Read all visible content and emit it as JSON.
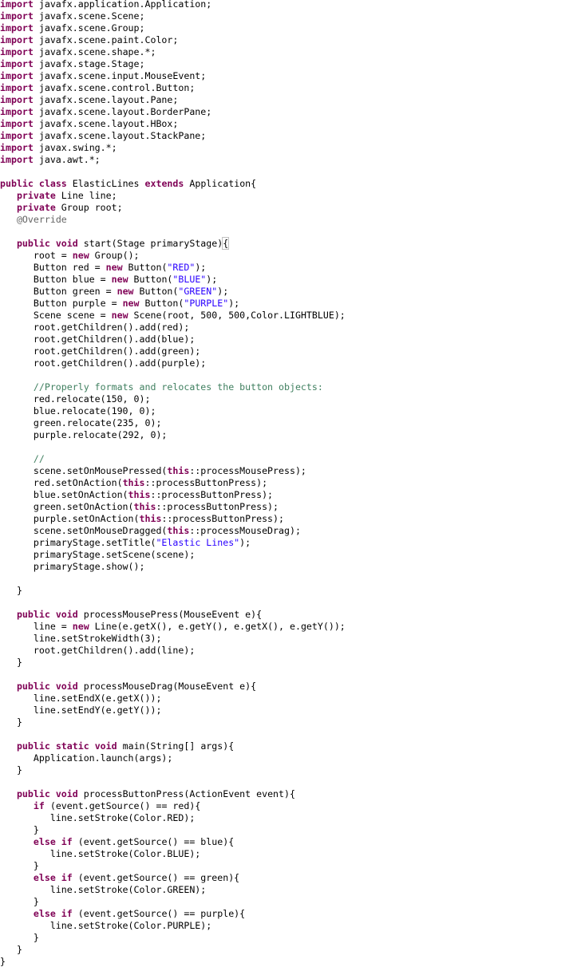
{
  "editor": {
    "language": "java",
    "file_class": "ElasticLines",
    "lines": [
      [
        {
          "t": "import",
          "k": "kw"
        },
        {
          "t": " javafx.application.Application;"
        }
      ],
      [
        {
          "t": "import",
          "k": "kw"
        },
        {
          "t": " javafx.scene.Scene;"
        }
      ],
      [
        {
          "t": "import",
          "k": "kw"
        },
        {
          "t": " javafx.scene.Group;"
        }
      ],
      [
        {
          "t": "import",
          "k": "kw"
        },
        {
          "t": " javafx.scene.paint.Color;"
        }
      ],
      [
        {
          "t": "import",
          "k": "kw"
        },
        {
          "t": " javafx.scene.shape.*;"
        }
      ],
      [
        {
          "t": "import",
          "k": "kw"
        },
        {
          "t": " javafx.stage.Stage;"
        }
      ],
      [
        {
          "t": "import",
          "k": "kw"
        },
        {
          "t": " javafx.scene.input.MouseEvent;"
        }
      ],
      [
        {
          "t": "import",
          "k": "kw"
        },
        {
          "t": " javafx.scene.control.Button;"
        }
      ],
      [
        {
          "t": "import",
          "k": "kw"
        },
        {
          "t": " javafx.scene.layout.Pane;"
        }
      ],
      [
        {
          "t": "import",
          "k": "kw"
        },
        {
          "t": " javafx.scene.layout.BorderPane;"
        }
      ],
      [
        {
          "t": "import",
          "k": "kw"
        },
        {
          "t": " javafx.scene.layout.HBox;"
        }
      ],
      [
        {
          "t": "import",
          "k": "kw"
        },
        {
          "t": " javafx.scene.layout.StackPane;"
        }
      ],
      [
        {
          "t": "import",
          "k": "kw"
        },
        {
          "t": " javax.swing.*;"
        }
      ],
      [
        {
          "t": "import",
          "k": "kw"
        },
        {
          "t": " java.awt.*;"
        }
      ],
      [],
      [
        {
          "t": "public",
          "k": "kw"
        },
        {
          "t": " "
        },
        {
          "t": "class",
          "k": "kw"
        },
        {
          "t": " ElasticLines "
        },
        {
          "t": "extends",
          "k": "kw"
        },
        {
          "t": " Application{"
        }
      ],
      [
        {
          "t": "   "
        },
        {
          "t": "private",
          "k": "kw"
        },
        {
          "t": " Line line;"
        }
      ],
      [
        {
          "t": "   "
        },
        {
          "t": "private",
          "k": "kw"
        },
        {
          "t": " Group root;"
        }
      ],
      [
        {
          "t": "   "
        },
        {
          "t": "@Override",
          "k": "ann"
        }
      ],
      [],
      [
        {
          "t": "   "
        },
        {
          "t": "public",
          "k": "kw"
        },
        {
          "t": " "
        },
        {
          "t": "void",
          "k": "kw"
        },
        {
          "t": " start(Stage primaryStage)"
        },
        {
          "t": "{",
          "k": "match"
        }
      ],
      [
        {
          "t": "      root = "
        },
        {
          "t": "new",
          "k": "kw"
        },
        {
          "t": " Group();"
        }
      ],
      [
        {
          "t": "      Button red = "
        },
        {
          "t": "new",
          "k": "kw"
        },
        {
          "t": " Button("
        },
        {
          "t": "\"RED\"",
          "k": "str"
        },
        {
          "t": ");"
        }
      ],
      [
        {
          "t": "      Button blue = "
        },
        {
          "t": "new",
          "k": "kw"
        },
        {
          "t": " Button("
        },
        {
          "t": "\"BLUE\"",
          "k": "str"
        },
        {
          "t": ");"
        }
      ],
      [
        {
          "t": "      Button green = "
        },
        {
          "t": "new",
          "k": "kw"
        },
        {
          "t": " Button("
        },
        {
          "t": "\"GREEN\"",
          "k": "str"
        },
        {
          "t": ");"
        }
      ],
      [
        {
          "t": "      Button purple = "
        },
        {
          "t": "new",
          "k": "kw"
        },
        {
          "t": " Button("
        },
        {
          "t": "\"PURPLE\"",
          "k": "str"
        },
        {
          "t": ");"
        }
      ],
      [
        {
          "t": "      Scene scene = "
        },
        {
          "t": "new",
          "k": "kw"
        },
        {
          "t": " Scene(root, 500, 500,Color.LIGHTBLUE);"
        }
      ],
      [
        {
          "t": "      root.getChildren().add(red);"
        }
      ],
      [
        {
          "t": "      root.getChildren().add(blue);"
        }
      ],
      [
        {
          "t": "      root.getChildren().add(green);"
        }
      ],
      [
        {
          "t": "      root.getChildren().add(purple);"
        }
      ],
      [],
      [
        {
          "t": "      "
        },
        {
          "t": "//Properly formats and relocates the button objects:",
          "k": "cm"
        }
      ],
      [
        {
          "t": "      red.relocate(150, 0);"
        }
      ],
      [
        {
          "t": "      blue.relocate(190, 0);"
        }
      ],
      [
        {
          "t": "      green.relocate(235, 0);"
        }
      ],
      [
        {
          "t": "      purple.relocate(292, 0);"
        }
      ],
      [],
      [
        {
          "t": "      "
        },
        {
          "t": "//",
          "k": "cm"
        }
      ],
      [
        {
          "t": "      scene.setOnMousePressed("
        },
        {
          "t": "this",
          "k": "kw"
        },
        {
          "t": "::processMousePress);"
        }
      ],
      [
        {
          "t": "      red.setOnAction("
        },
        {
          "t": "this",
          "k": "kw"
        },
        {
          "t": "::processButtonPress);"
        }
      ],
      [
        {
          "t": "      blue.setOnAction("
        },
        {
          "t": "this",
          "k": "kw"
        },
        {
          "t": "::processButtonPress);"
        }
      ],
      [
        {
          "t": "      green.setOnAction("
        },
        {
          "t": "this",
          "k": "kw"
        },
        {
          "t": "::processButtonPress);"
        }
      ],
      [
        {
          "t": "      purple.setOnAction("
        },
        {
          "t": "this",
          "k": "kw"
        },
        {
          "t": "::processButtonPress);"
        }
      ],
      [
        {
          "t": "      scene.setOnMouseDragged("
        },
        {
          "t": "this",
          "k": "kw"
        },
        {
          "t": "::processMouseDrag);"
        }
      ],
      [
        {
          "t": "      primaryStage.setTitle("
        },
        {
          "t": "\"Elastic Lines\"",
          "k": "str"
        },
        {
          "t": ");"
        }
      ],
      [
        {
          "t": "      primaryStage.setScene(scene);"
        }
      ],
      [
        {
          "t": "      primaryStage.show();"
        }
      ],
      [],
      [
        {
          "t": "   }"
        }
      ],
      [],
      [
        {
          "t": "   "
        },
        {
          "t": "public",
          "k": "kw"
        },
        {
          "t": " "
        },
        {
          "t": "void",
          "k": "kw"
        },
        {
          "t": " processMousePress(MouseEvent e){"
        }
      ],
      [
        {
          "t": "      line = "
        },
        {
          "t": "new",
          "k": "kw"
        },
        {
          "t": " Line(e.getX(), e.getY(), e.getX(), e.getY());"
        }
      ],
      [
        {
          "t": "      line.setStrokeWidth(3);"
        }
      ],
      [
        {
          "t": "      root.getChildren().add(line);"
        }
      ],
      [
        {
          "t": "   }"
        }
      ],
      [],
      [
        {
          "t": "   "
        },
        {
          "t": "public",
          "k": "kw"
        },
        {
          "t": " "
        },
        {
          "t": "void",
          "k": "kw"
        },
        {
          "t": " processMouseDrag(MouseEvent e){"
        }
      ],
      [
        {
          "t": "      line.setEndX(e.getX());"
        }
      ],
      [
        {
          "t": "      line.setEndY(e.getY());"
        }
      ],
      [
        {
          "t": "   }"
        }
      ],
      [],
      [
        {
          "t": "   "
        },
        {
          "t": "public",
          "k": "kw"
        },
        {
          "t": " "
        },
        {
          "t": "static",
          "k": "kw"
        },
        {
          "t": " "
        },
        {
          "t": "void",
          "k": "kw"
        },
        {
          "t": " main(String[] args){"
        }
      ],
      [
        {
          "t": "      Application.launch(args);"
        }
      ],
      [
        {
          "t": "   }"
        }
      ],
      [],
      [
        {
          "t": "   "
        },
        {
          "t": "public",
          "k": "kw"
        },
        {
          "t": " "
        },
        {
          "t": "void",
          "k": "kw"
        },
        {
          "t": " processButtonPress(ActionEvent event){"
        }
      ],
      [
        {
          "t": "      "
        },
        {
          "t": "if",
          "k": "kw"
        },
        {
          "t": " (event.getSource() == red){"
        }
      ],
      [
        {
          "t": "         line.setStroke(Color.RED);"
        }
      ],
      [
        {
          "t": "      }"
        }
      ],
      [
        {
          "t": "      "
        },
        {
          "t": "else",
          "k": "kw"
        },
        {
          "t": " "
        },
        {
          "t": "if",
          "k": "kw"
        },
        {
          "t": " (event.getSource() == blue){"
        }
      ],
      [
        {
          "t": "         line.setStroke(Color.BLUE);"
        }
      ],
      [
        {
          "t": "      }"
        }
      ],
      [
        {
          "t": "      "
        },
        {
          "t": "else",
          "k": "kw"
        },
        {
          "t": " "
        },
        {
          "t": "if",
          "k": "kw"
        },
        {
          "t": " (event.getSource() == green){"
        }
      ],
      [
        {
          "t": "         line.setStroke(Color.GREEN);"
        }
      ],
      [
        {
          "t": "      }"
        }
      ],
      [
        {
          "t": "      "
        },
        {
          "t": "else",
          "k": "kw"
        },
        {
          "t": " "
        },
        {
          "t": "if",
          "k": "kw"
        },
        {
          "t": " (event.getSource() == purple){"
        }
      ],
      [
        {
          "t": "         line.setStroke(Color.PURPLE);"
        }
      ],
      [
        {
          "t": "      }"
        }
      ],
      [
        {
          "t": "   }"
        }
      ],
      [
        {
          "t": "}"
        }
      ]
    ]
  },
  "colors": {
    "keyword": "#7f0055",
    "string": "#2a00ff",
    "comment": "#3f7f5f",
    "annotation": "#646464",
    "text": "#000000",
    "background": "#ffffff"
  }
}
